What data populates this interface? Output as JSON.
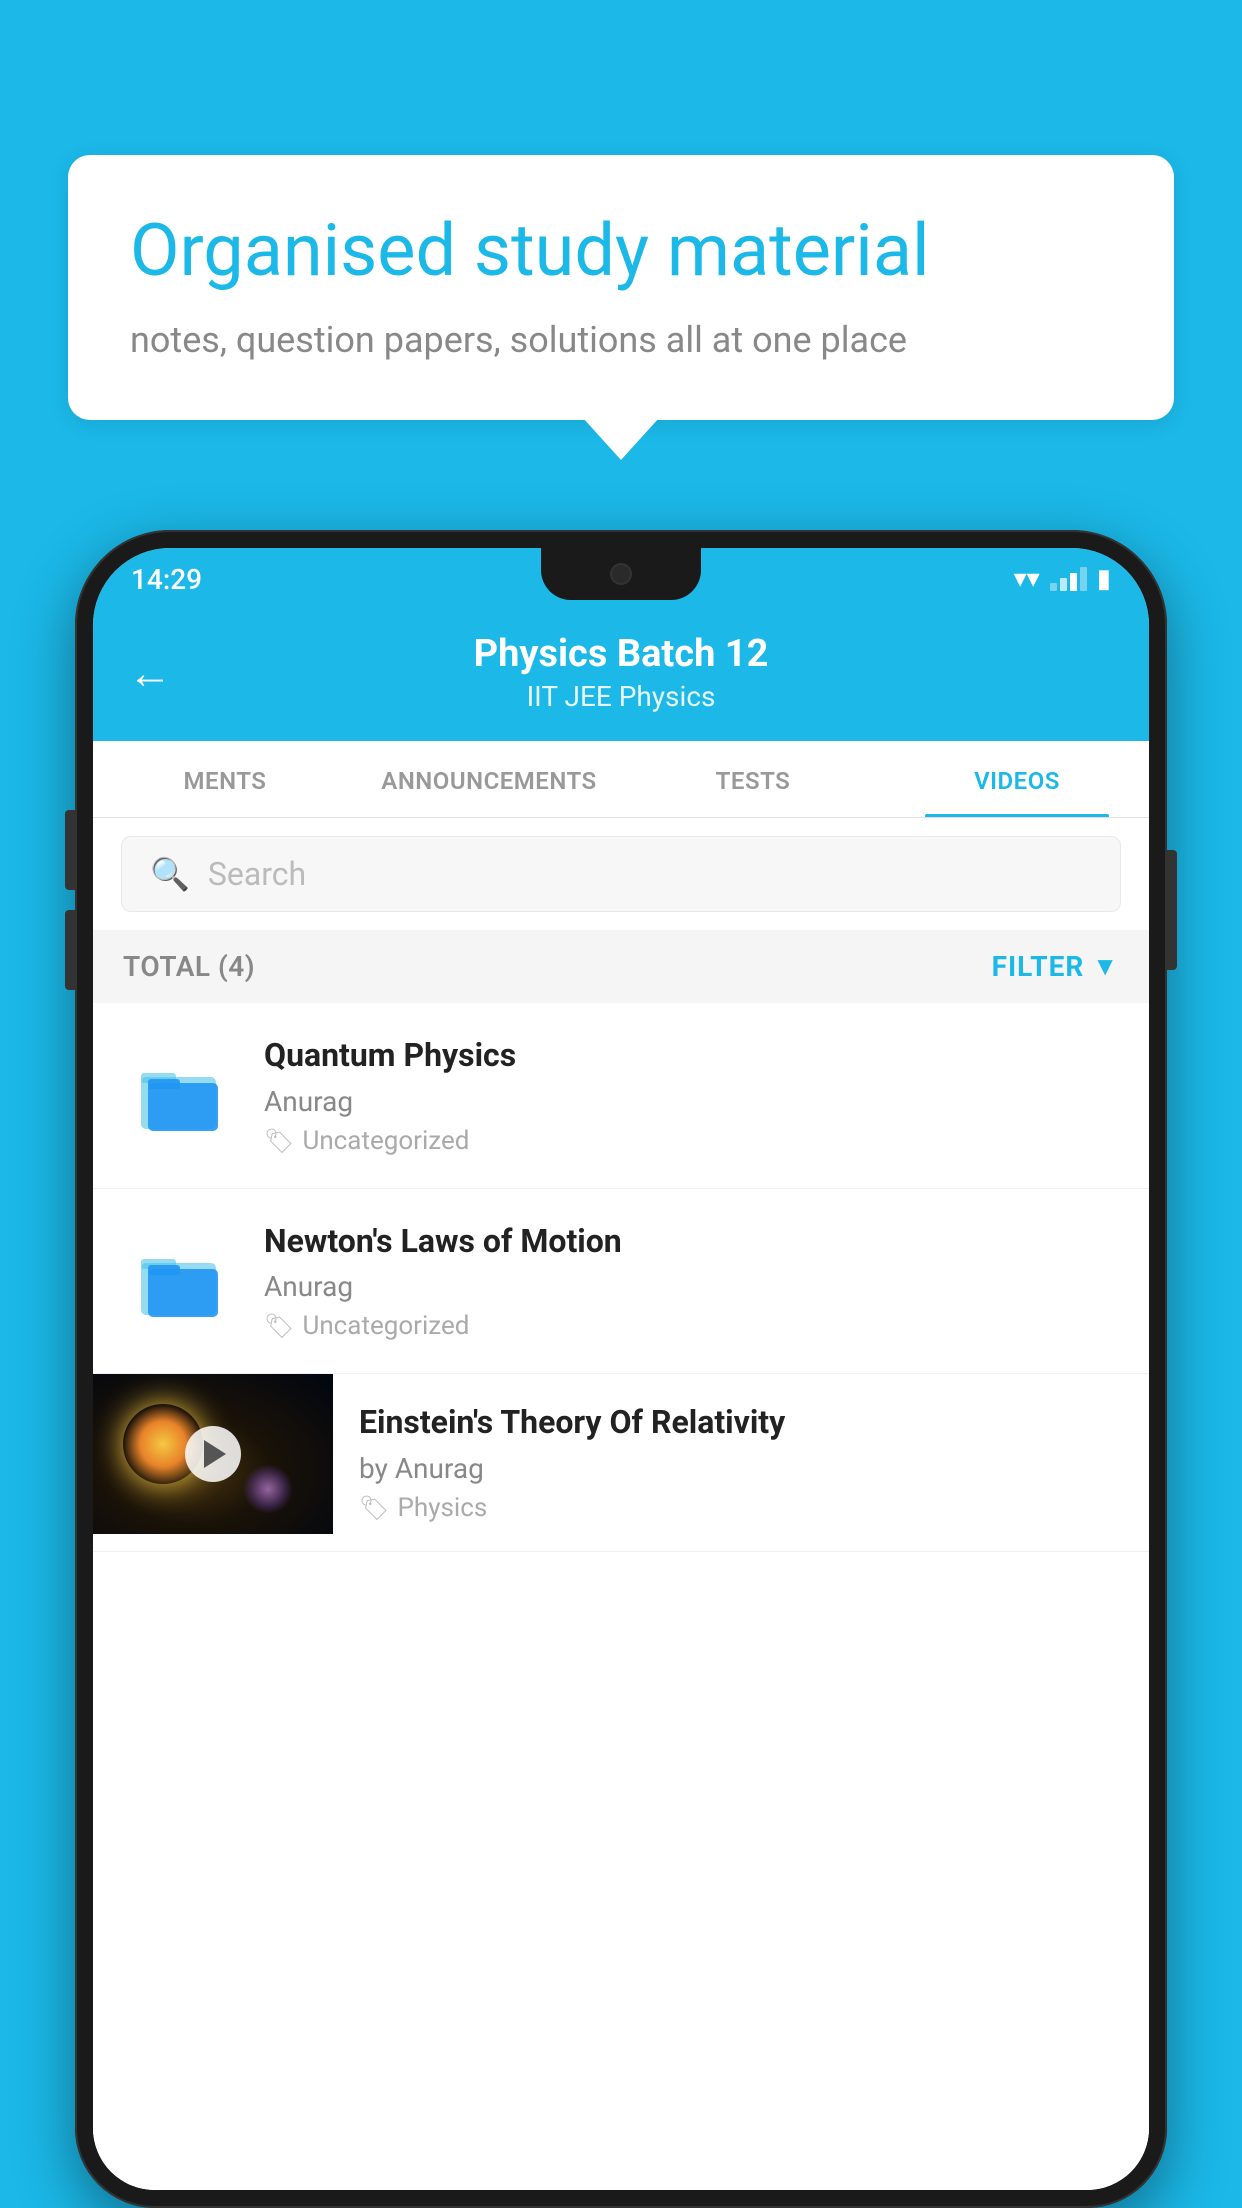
{
  "background_color": "#1BB8E8",
  "bubble": {
    "title": "Organised study material",
    "subtitle": "notes, question papers, solutions all at one place"
  },
  "status_bar": {
    "time": "14:29",
    "wifi": "wifi",
    "battery": "battery"
  },
  "header": {
    "title": "Physics Batch 12",
    "subtitle": "IIT JEE   Physics",
    "back_label": "←"
  },
  "tabs": [
    {
      "label": "MENTS",
      "active": false
    },
    {
      "label": "ANNOUNCEMENTS",
      "active": false
    },
    {
      "label": "TESTS",
      "active": false
    },
    {
      "label": "VIDEOS",
      "active": true
    }
  ],
  "search": {
    "placeholder": "Search"
  },
  "filter_bar": {
    "total_label": "TOTAL (4)",
    "filter_label": "FILTER"
  },
  "videos": [
    {
      "title": "Quantum Physics",
      "author": "Anurag",
      "tag": "Uncategorized",
      "type": "folder"
    },
    {
      "title": "Newton's Laws of Motion",
      "author": "Anurag",
      "tag": "Uncategorized",
      "type": "folder"
    },
    {
      "title": "Einstein's Theory Of Relativity",
      "author": "by Anurag",
      "tag": "Physics",
      "type": "video"
    }
  ]
}
